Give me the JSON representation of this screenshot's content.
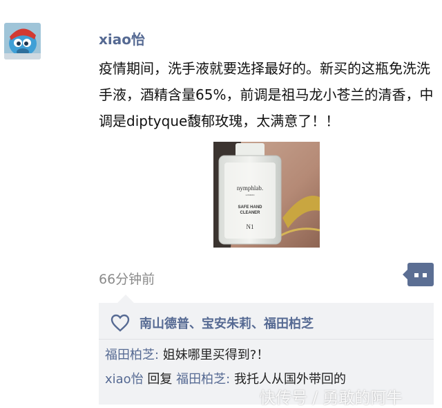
{
  "post": {
    "author": "xiao怡",
    "text": "疫情期间，洗手液就要选择最好的。新买的这瓶免洗洗手液，酒精含量65%，前调是祖马龙小苍兰的清香，中调是diptyque馥郁玫瑰，太满意了！！",
    "image": {
      "brand": "nymphlab.",
      "brand_sub": "LONDON",
      "product_line1": "SAFE HAND",
      "product_line2": "CLEANER",
      "number": "N1"
    },
    "timestamp": "66分钟前"
  },
  "likes": {
    "names": "南山德普、宝安朱莉、福田柏芝"
  },
  "comments": [
    {
      "author": "福田柏芝",
      "separator": ": ",
      "text": "姐妹哪里买得到?！"
    },
    {
      "author": "xiao怡",
      "reply_word": " 回复 ",
      "reply_to": "福田柏芝",
      "separator": ": ",
      "text": "我托人从国外带回的"
    }
  ],
  "watermark": "快传号 / 勇敢的阿牛",
  "colors": {
    "link_blue": "#566a93",
    "button": "#5b6e93",
    "panel_bg": "#f1f2f4",
    "timestamp": "#8a8a8a"
  }
}
